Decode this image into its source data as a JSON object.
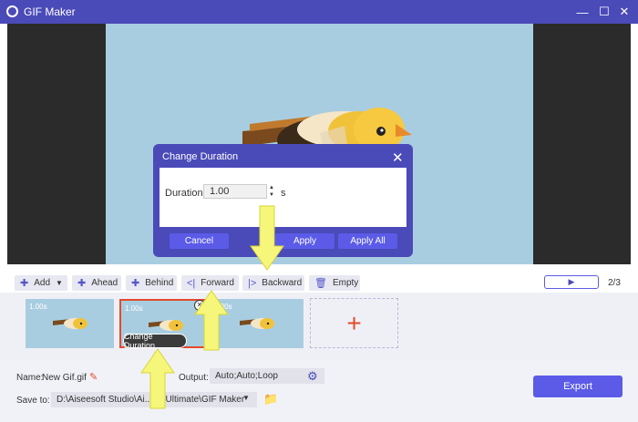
{
  "window": {
    "title": "GIF Maker"
  },
  "dialog": {
    "title": "Change Duration",
    "duration_label": "Duration:",
    "duration_value": "1.00",
    "unit": "s",
    "cancel_label": "Cancel",
    "apply_label": "Apply",
    "apply_all_label": "Apply All"
  },
  "toolbar": {
    "add": "Add",
    "ahead": "Ahead",
    "behind": "Behind",
    "forward": "Forward",
    "backward": "Backward",
    "empty": "Empty",
    "page_count": "2/3"
  },
  "frames": [
    {
      "duration": "1.00s"
    },
    {
      "duration": "1.00s",
      "action": "Change Duration"
    },
    {
      "duration": "1.00s"
    }
  ],
  "bottom": {
    "name_label": "Name:",
    "name_value": "New Gif.gif",
    "output_label": "Output:",
    "output_value": "Auto;Auto;Loop",
    "save_label": "Save to:",
    "save_path": "D:\\Aiseesoft Studio\\Ai...ter Ultimate\\GIF Maker",
    "export_label": "Export"
  },
  "colors": {
    "accent": "#5b5be8",
    "titlebar": "#4a4ab8",
    "add_plus": "#e34a2b",
    "arrow": "#f6f67a"
  }
}
